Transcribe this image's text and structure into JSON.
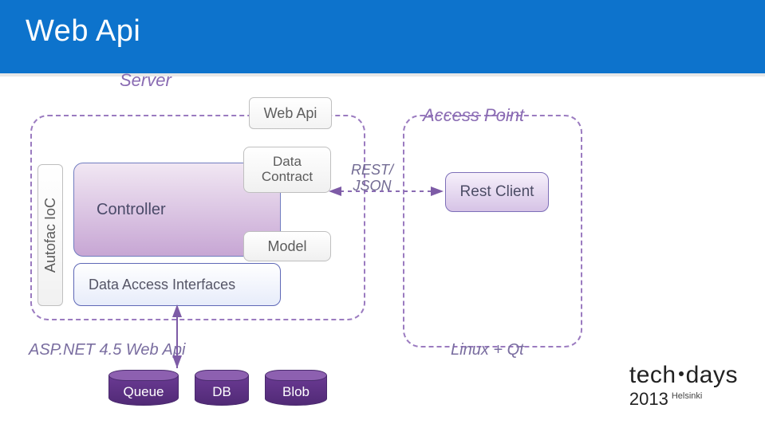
{
  "header": {
    "title": "Web Api"
  },
  "groups": {
    "server_label": "Server",
    "access_label": "Access Point"
  },
  "boxes": {
    "webapi": "Web Api",
    "autofac": "Autofac IoC",
    "controller": "Controller",
    "dai": "Data Access Interfaces",
    "contract": "Data\nContract",
    "model": "Model",
    "restclient": "Rest Client"
  },
  "labels": {
    "restjson": "REST/\nJSON",
    "aspnet": "ASP.NET 4.5 Web Api",
    "linuxqt": "Linux + Qt"
  },
  "cylinders": {
    "queue": "Queue",
    "db": "DB",
    "blob": "Blob"
  },
  "logo": {
    "brand1": "tech",
    "brand2": "days",
    "year": "2013",
    "city": "Helsinki"
  }
}
